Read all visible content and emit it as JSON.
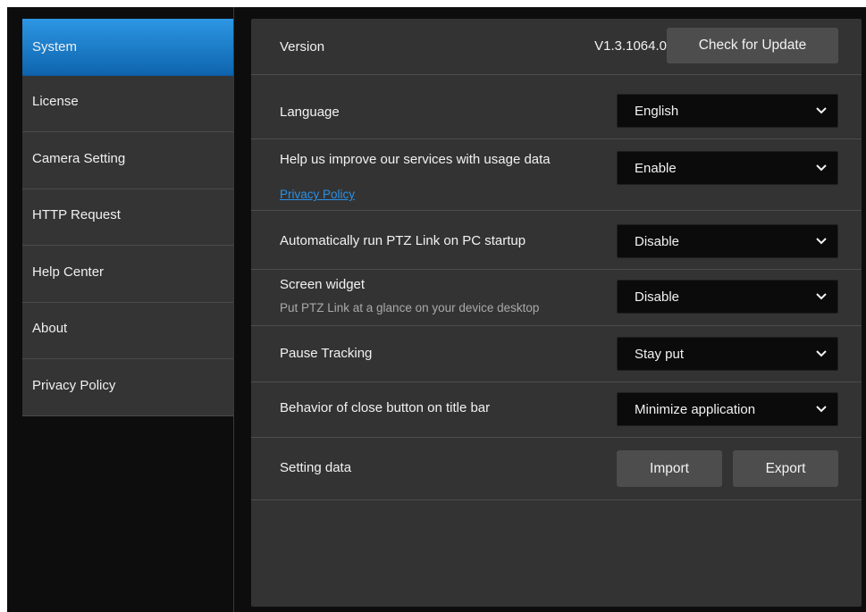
{
  "sidebar": {
    "items": [
      {
        "label": "System",
        "active": true
      },
      {
        "label": "License"
      },
      {
        "label": "Camera Setting"
      },
      {
        "label": "HTTP Request"
      },
      {
        "label": "Help Center"
      },
      {
        "label": "About"
      },
      {
        "label": "Privacy Policy"
      }
    ]
  },
  "settings": {
    "version": {
      "label": "Version",
      "value": "V1.3.1064.0",
      "button": "Check for Update"
    },
    "language": {
      "label": "Language",
      "selected": "English"
    },
    "usage_data": {
      "label": "Help us improve our services with usage data",
      "link": "Privacy Policy",
      "selected": "Enable"
    },
    "autorun": {
      "label": "Automatically run PTZ Link on PC startup",
      "selected": "Disable"
    },
    "widget": {
      "label": "Screen widget",
      "sublabel": "Put PTZ Link at a glance on your device desktop",
      "selected": "Disable"
    },
    "pause_tracking": {
      "label": "Pause Tracking",
      "selected": "Stay put"
    },
    "close_behavior": {
      "label": "Behavior of close button on title bar",
      "selected": "Minimize application"
    },
    "setting_data": {
      "label": "Setting data",
      "import": "Import",
      "export": "Export"
    }
  },
  "colors": {
    "accent": "#1d7ccb",
    "link": "#2b8fe6",
    "panel": "#333333",
    "background": "#0d0d0d"
  }
}
